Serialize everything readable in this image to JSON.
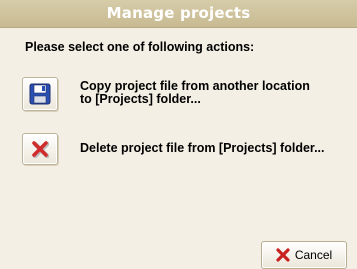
{
  "dialog": {
    "title": "Manage projects",
    "prompt": "Please select one of following actions:"
  },
  "actions": [
    {
      "icon": "floppy-disk-icon",
      "label": "Copy project file from another location\nto [Projects] folder..."
    },
    {
      "icon": "red-x-icon",
      "label": "Delete project file from [Projects] folder..."
    }
  ],
  "footer": {
    "cancel_label": "Cancel",
    "cancel_icon": "red-x-icon"
  },
  "colors": {
    "titlebar": "#cfc39d",
    "background": "#f3efe4",
    "accent_red": "#cc2020",
    "floppy_blue": "#2b4fb0"
  }
}
